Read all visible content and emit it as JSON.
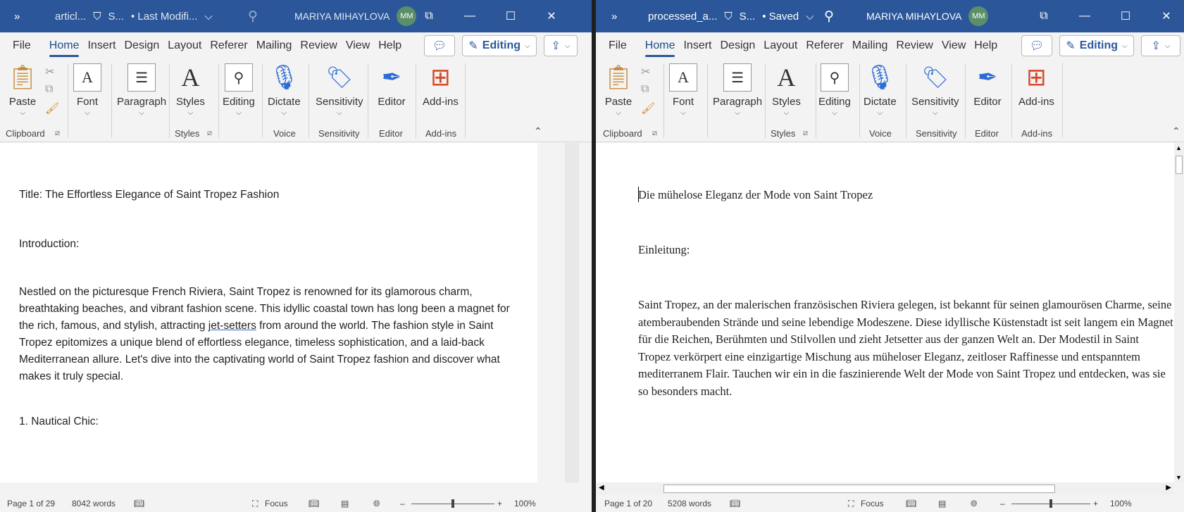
{
  "left": {
    "title": {
      "doc_name": "articl...",
      "saved_status": "S...",
      "modified": "• Last Modifi...",
      "user": "MARIYA MIHAYLOVA",
      "initials": "MM"
    },
    "tabs": [
      "File",
      "Home",
      "Insert",
      "Design",
      "Layout",
      "Referer",
      "Mailing",
      "Review",
      "View",
      "Help"
    ],
    "editing_label": "Editing",
    "ribbon": {
      "paste": "Paste",
      "font": "Font",
      "paragraph": "Paragraph",
      "styles": "Styles",
      "editing": "Editing",
      "dictate": "Dictate",
      "sensitivity": "Sensitivity",
      "editor": "Editor",
      "addins": "Add-ins",
      "g_clipboard": "Clipboard",
      "g_styles": "Styles",
      "g_voice": "Voice",
      "g_sensitivity": "Sensitivity",
      "g_editor": "Editor",
      "g_addins": "Add-ins"
    },
    "doc": {
      "title_line": "Title: The Effortless Elegance of Saint Tropez Fashion",
      "intro": "Introduction:",
      "body_a": "Nestled on the picturesque French Riviera, Saint Tropez is renowned for its glamorous charm, breathtaking beaches, and vibrant fashion scene. This idyllic coastal town has long been a magnet for the rich, famous, and stylish, attracting ",
      "body_link": "jet-setters",
      "body_b": " from around the world. The fashion style in Saint Tropez epitomizes a unique blend of effortless elegance, timeless sophistication, and a laid-back Mediterranean allure. Let's dive into the captivating world of Saint Tropez fashion and discover what makes it truly special.",
      "section1": "1. Nautical Chic:"
    },
    "status": {
      "page": "Page 1 of 29",
      "words": "8042 words",
      "focus": "Focus",
      "zoom": "100%"
    }
  },
  "right": {
    "title": {
      "doc_name": "processed_a...",
      "saved_status": "S...",
      "modified": "• Saved",
      "user": "MARIYA MIHAYLOVA",
      "initials": "MM"
    },
    "tabs": [
      "File",
      "Home",
      "Insert",
      "Design",
      "Layout",
      "Referer",
      "Mailing",
      "Review",
      "View",
      "Help"
    ],
    "editing_label": "Editing",
    "ribbon": {
      "paste": "Paste",
      "font": "Font",
      "paragraph": "Paragraph",
      "styles": "Styles",
      "editing": "Editing",
      "dictate": "Dictate",
      "sensitivity": "Sensitivity",
      "editor": "Editor",
      "addins": "Add-ins",
      "g_clipboard": "Clipboard",
      "g_styles": "Styles",
      "g_voice": "Voice",
      "g_sensitivity": "Sensitivity",
      "g_editor": "Editor",
      "g_addins": "Add-ins"
    },
    "doc": {
      "title_line": "Die mühelose Eleganz der Mode von Saint Tropez",
      "intro": "Einleitung:",
      "body": "Saint Tropez, an der malerischen französischen Riviera gelegen, ist bekannt für seinen glamourösen Charme, seine atemberaubenden Strände und seine lebendige Modeszene. Diese idyllische Küstenstadt ist seit langem ein Magnet für die Reichen, Berühmten und Stilvollen und zieht Jetsetter aus der ganzen Welt an. Der Modestil in Saint Tropez verkörpert eine einzigartige Mischung aus müheloser Eleganz, zeitloser Raffinesse und entspanntem mediterranem Flair. Tauchen wir ein in die faszinierende Welt der Mode von Saint Tropez und entdecken, was sie so besonders macht."
    },
    "status": {
      "page": "Page 1 of 20",
      "words": "5208 words",
      "focus": "Focus",
      "zoom": "100%"
    }
  },
  "colors": {
    "titlebar": "#2b579a",
    "accent": "#2b579a"
  }
}
